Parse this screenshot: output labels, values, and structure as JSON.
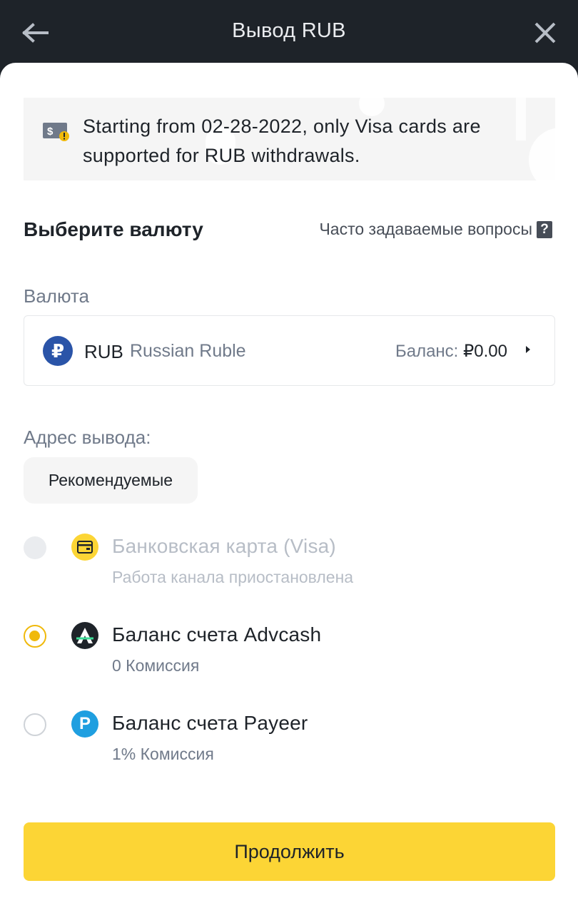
{
  "header": {
    "title": "Вывод RUB",
    "back_icon": "arrow-left-icon",
    "close_icon": "close-icon"
  },
  "banner": {
    "text": "Starting from 02-28-2022, only Visa cards are supported for RUB withdrawals.",
    "icon": "dollar-card-warning-icon"
  },
  "section": {
    "title": "Выберите валюту",
    "faq_label": "Часто задаваемые вопросы",
    "faq_icon": "question-icon"
  },
  "currency": {
    "label": "Валюта",
    "symbol": "₽",
    "code": "RUB",
    "name": "Russian Ruble",
    "balance_label": "Баланс:",
    "balance_value": "₽0.00"
  },
  "withdraw": {
    "label": "Адрес вывода:",
    "chip": "Рекомендуемые",
    "options": [
      {
        "title": "Банковская карта (Visa)",
        "subtitle": "Работа канала приостановлена",
        "state": "disabled",
        "icon": "bank-card-icon"
      },
      {
        "title": "Баланс счета Advcash",
        "subtitle": "0 Комиссия",
        "state": "selected",
        "icon": "advcash-icon"
      },
      {
        "title": "Баланс счета Payeer",
        "subtitle": "1% Комиссия",
        "state": "unselected",
        "icon": "payeer-icon"
      }
    ]
  },
  "actions": {
    "continue_label": "Продолжить"
  },
  "colors": {
    "accent": "#fcd535",
    "radio_selected": "#f0b90b",
    "header_bg": "#1e2329",
    "ruble_coin": "#2a54a8"
  }
}
